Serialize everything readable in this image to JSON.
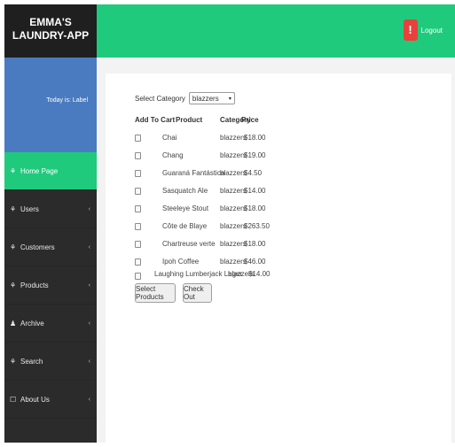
{
  "brand": {
    "line1": "EMMA'S",
    "line2": "LAUNDRY-APP"
  },
  "user_panel": {
    "today_label": "Today is: Label"
  },
  "nav": {
    "items": [
      {
        "label": "Home Page",
        "icon": "leaf-icon",
        "glyph": "⚘",
        "active": true
      },
      {
        "label": "Users",
        "icon": "leaf-icon",
        "glyph": "⚘",
        "chevron": "‹"
      },
      {
        "label": "Customers",
        "icon": "leaf-icon",
        "glyph": "⚘",
        "chevron": "‹"
      },
      {
        "label": "Products",
        "icon": "leaf-icon",
        "glyph": "⚘",
        "chevron": "‹"
      },
      {
        "label": "Archive",
        "icon": "users-icon",
        "glyph": "♟",
        "chevron": "‹"
      },
      {
        "label": "Search",
        "icon": "leaf-icon",
        "glyph": "⚘",
        "chevron": "‹"
      },
      {
        "label": "About Us",
        "icon": "square-icon",
        "glyph": "☐",
        "chevron": "‹"
      }
    ]
  },
  "topbar": {
    "logout_label": "Logout",
    "logout_glyph": "!"
  },
  "filter": {
    "label": "Select Category",
    "selected": "blazzers",
    "arrow": "▾"
  },
  "table": {
    "headers": {
      "add_to_cart": "Add To Cart",
      "product": "Product",
      "category": "Category",
      "price": "Price"
    },
    "rows": [
      {
        "product": "Chai",
        "category": "blazzers",
        "price": "$18.00"
      },
      {
        "product": "Chang",
        "category": "blazzers",
        "price": "$19.00"
      },
      {
        "product": "Guaraná Fantástica",
        "category": "blazzers",
        "price": "$4.50"
      },
      {
        "product": "Sasquatch Ale",
        "category": "blazzers",
        "price": "$14.00"
      },
      {
        "product": "Steeleye Stout",
        "category": "blazzers",
        "price": "$18.00"
      },
      {
        "product": "Côte de Blaye",
        "category": "blazzers",
        "price": "$263.50"
      },
      {
        "product": "Chartreuse verte",
        "category": "blazzers",
        "price": "$18.00"
      },
      {
        "product": "Ipoh Coffee",
        "category": "blazzers",
        "price": "$46.00"
      },
      {
        "product": "Laughing Lumberjack Lager",
        "category": "blazzers",
        "price": "$14.00"
      }
    ]
  },
  "actions": {
    "select_products": "Select Products",
    "check_out": "Check Out"
  },
  "colors": {
    "accent": "#1fca7d",
    "sidebar": "#2b2b2b",
    "user_panel": "#4a7bc0",
    "logout": "#e8413c"
  }
}
